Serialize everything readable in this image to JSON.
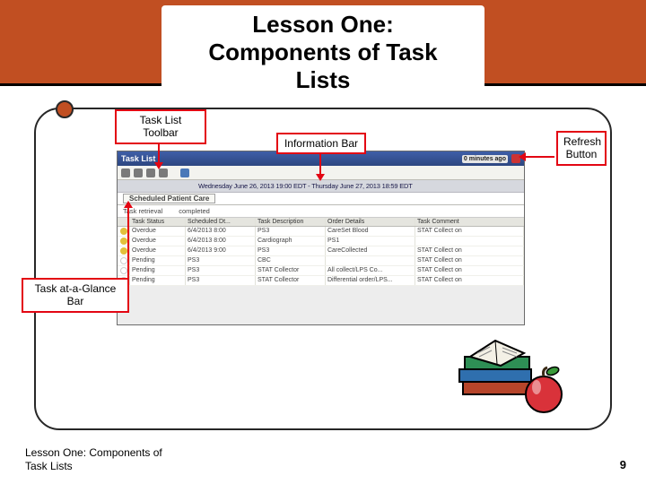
{
  "title": {
    "line1": "Lesson One:",
    "line2": "Components of Task Lists"
  },
  "callouts": {
    "toolbar": "Task List Toolbar",
    "infobar": "Information Bar",
    "refresh": "Refresh Button",
    "glance": "Task at-a-Glance Bar"
  },
  "shot": {
    "title": "Task List",
    "minago": "0 minutes ago",
    "info": "Wednesday  June 26, 2013 19:00 EDT  -  Thursday  June 27, 2013 18:59 EDT",
    "tab": "Scheduled Patient Care",
    "glance": {
      "left": "Task retrieval",
      "right": "completed"
    },
    "columns": [
      "",
      "Task Status",
      "Scheduled Dt...",
      "Task Description",
      "Order Details",
      "Task Comment"
    ],
    "rows": [
      {
        "status": "Overdue",
        "dt": "6/4/2013 8:00",
        "desc": "PS3",
        "order": "CareSet Blood",
        "comment": "STAT Collect on"
      },
      {
        "status": "Overdue",
        "dt": "6/4/2013 8:00",
        "desc": "Cardiograph",
        "order": "PS1",
        "comment": ""
      },
      {
        "status": "Overdue",
        "dt": "6/4/2013 9:00",
        "desc": "PS3",
        "order": "CareCollected",
        "comment": "STAT Collect on"
      },
      {
        "status": "Pending",
        "dt": "PS3",
        "desc": "CBC",
        "order": "",
        "comment": "STAT Collect on"
      },
      {
        "status": "Pending",
        "dt": "PS3",
        "desc": "STAT Collector",
        "order": "All collect/LPS Co...",
        "comment": "STAT Collect on"
      },
      {
        "status": "Pending",
        "dt": "PS3",
        "desc": "STAT Collector",
        "order": "Differential order/LPS...",
        "comment": "STAT Collect on"
      }
    ]
  },
  "footer": {
    "l1": "Lesson One: Components of",
    "l2": "Task Lists"
  },
  "page": "9"
}
